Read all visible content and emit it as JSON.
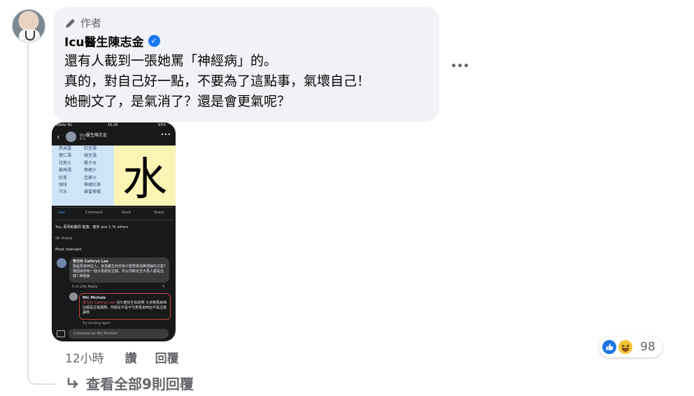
{
  "comment": {
    "author_badge": "作者",
    "author_name": "Icu醫生陳志金",
    "lines": [
      "還有人截到一張她罵「神經病」的。",
      "真的，對自己好一點，不要為了這點事，氣壞自己！",
      "她刪文了，是氣消了？還是會更氣呢？"
    ],
    "time": "12小時",
    "actions": {
      "like": "讚",
      "reply": "回覆"
    },
    "reactions": {
      "count": "98",
      "types": [
        "like-icon",
        "haha-icon"
      ]
    }
  },
  "view_replies": "查看全部9則回覆",
  "screenshot": {
    "status_left": "Mobile 4G",
    "status_time": "16:26",
    "status_right": "93%",
    "header_name": "Icu醫生陳志金",
    "header_time": "6 h",
    "drinks_left": [
      "西米露",
      "薏仁湯",
      "甘蔗汁",
      "酸梅湯",
      "奶茶",
      "咖啡",
      "汽水"
    ],
    "drinks_right": [
      "紅豆湯",
      "綠豆湯",
      "椰子水",
      "檸檬汁",
      "芭樂汁",
      "檸檬紅茶",
      "蜂蜜檸檬"
    ],
    "big_char": "水",
    "actions": [
      "Like",
      "Comment",
      "Send",
      "Share"
    ],
    "reactions_line": "You, 蔡明劼醫師 健康。瘦身 and 3.7k others",
    "shares": "58 shares",
    "sort": "Most relevant",
    "comment1_author": "李元玲 Cathryn Lee",
    "comment1_text": "我是馬來西亞人。身為醫生的你為什麼要寫毫無根據的文案? 我因為你有一個大馬朋友這樣，所以你斷定全大馬人都是這樣? 神經病",
    "comment1_meta": "5 m   Like   Reply",
    "comment1_reacts": "5",
    "comment2_author": "Mic Michele",
    "comment2_mention": "李元玲 Cathryn Lee",
    "comment2_text": "沒什麼好生氣的啊 大多數馬來西亞都是這樣講啊。你朋友不是不代表馬來西亞不是這樣講啊",
    "retry": "Try sending again",
    "input_placeholder": "Comment as Mic Michele"
  }
}
